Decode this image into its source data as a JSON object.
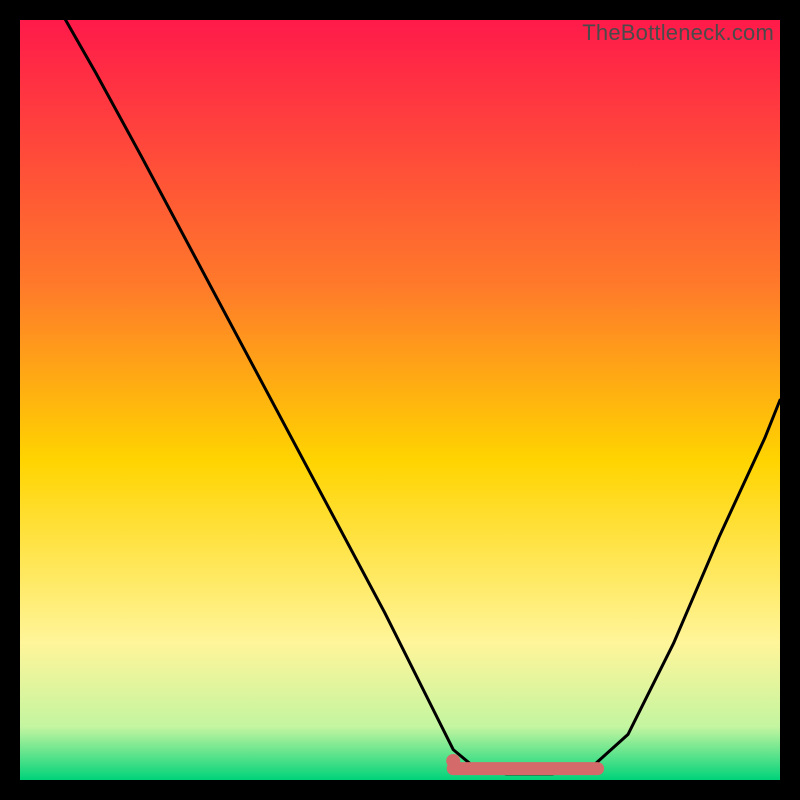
{
  "attribution": "TheBottleneck.com",
  "colors": {
    "bg": "#000000",
    "curve": "#000000",
    "marker_fill": "#d46a6a",
    "marker_stroke": "#d46a6a",
    "grad_top": "#ff1a4a",
    "grad_mid1": "#ff7a2a",
    "grad_mid2": "#ffd400",
    "grad_mid3": "#fff59a",
    "grad_bottom1": "#c4f5a0",
    "grad_bottom2": "#00d37a"
  },
  "chart_data": {
    "type": "line",
    "title": "",
    "xlabel": "",
    "ylabel": "",
    "xlim": [
      0,
      100
    ],
    "ylim": [
      0,
      100
    ],
    "curve": [
      {
        "x": 6,
        "y": 100
      },
      {
        "x": 10,
        "y": 93
      },
      {
        "x": 16,
        "y": 82
      },
      {
        "x": 24,
        "y": 67
      },
      {
        "x": 32,
        "y": 52
      },
      {
        "x": 40,
        "y": 37
      },
      {
        "x": 48,
        "y": 22
      },
      {
        "x": 54,
        "y": 10
      },
      {
        "x": 57,
        "y": 4
      },
      {
        "x": 60,
        "y": 1.5
      },
      {
        "x": 64,
        "y": 0.8
      },
      {
        "x": 70,
        "y": 0.8
      },
      {
        "x": 75,
        "y": 1.5
      },
      {
        "x": 80,
        "y": 6
      },
      {
        "x": 86,
        "y": 18
      },
      {
        "x": 92,
        "y": 32
      },
      {
        "x": 98,
        "y": 45
      },
      {
        "x": 100,
        "y": 50
      }
    ],
    "optimal_band": {
      "x_start": 57,
      "x_end": 76,
      "y": 1.5
    },
    "marker_dot": {
      "x": 57,
      "y": 2.5
    }
  }
}
